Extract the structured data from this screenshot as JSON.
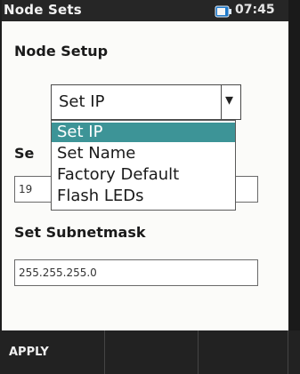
{
  "statusbar": {
    "title": "Node Sets",
    "time": "07:45",
    "battery_icon": "battery-icon"
  },
  "page": {
    "title": "Node Setup"
  },
  "mode_select": {
    "value": "Set IP",
    "options": [
      "Set IP",
      "Set Name",
      "Factory Default",
      "Flash LEDs"
    ],
    "selected_index": 0
  },
  "ip_field": {
    "label": "Se",
    "value": "19"
  },
  "subnet_field": {
    "label": "Set Subnetmask",
    "value": "255.255.255.0"
  },
  "softkeys": {
    "apply_label": "APPLY"
  },
  "colors": {
    "highlight": "#3d9497",
    "statusbar": "#262626",
    "softkey_bar": "#222222"
  }
}
